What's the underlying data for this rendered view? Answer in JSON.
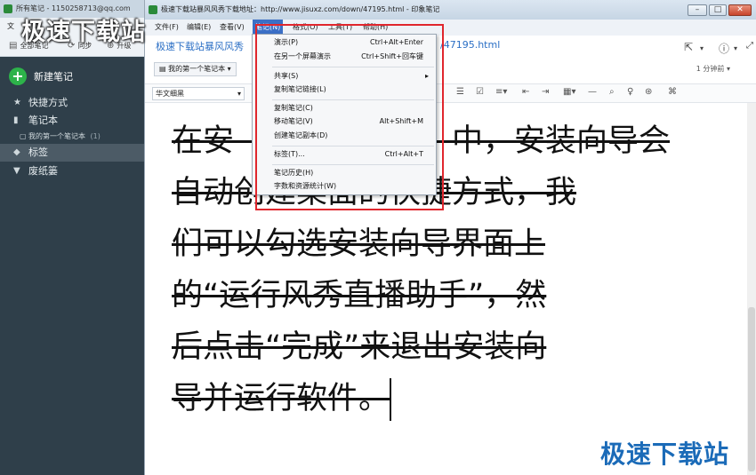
{
  "left_window": {
    "title": "所有笔记 - 1150258713@qq.com",
    "menu": [
      "文",
      "查"
    ],
    "toolbar": {
      "all_notes": "全部笔记",
      "sync": "同步",
      "upgrade": "升级"
    },
    "new_note": "新建笔记",
    "nav": {
      "shortcuts": "快捷方式",
      "notebooks": "笔记本",
      "my_first_notebook": "我的第一个笔记本",
      "my_first_notebook_count": "(1)",
      "tags": "标签",
      "trash": "废纸篓"
    }
  },
  "main_window": {
    "title": "极速下载站暴风风秀下载地址：http://www.jisuxz.com/down/47195.html - 印象笔记",
    "menu": {
      "file": "文件(F)",
      "edit": "编辑(E)",
      "view": "查看(V)",
      "note": "笔记(N)",
      "format": "格式(O)",
      "tools": "工具(T)",
      "help": "帮助(H)"
    },
    "note_title_left": "极速下载站暴风风秀",
    "note_title_right": "/47195.html",
    "notebook_selector": "我的第一个笔记本",
    "time_ago": "1 分钟前",
    "font_name": "华文细黑"
  },
  "note_menu": {
    "present": {
      "label": "演示(P)",
      "shortcut": "Ctrl+Alt+Enter"
    },
    "present_other": {
      "label": "在另一个屏幕演示",
      "shortcut": "Ctrl+Shift+回车键"
    },
    "share": {
      "label": "共享(S)"
    },
    "copy_link": {
      "label": "复制笔记链接(L)"
    },
    "copy_note": {
      "label": "复制笔记(C)"
    },
    "move_note": {
      "label": "移动笔记(V)",
      "shortcut": "Alt+Shift+M"
    },
    "create_copy": {
      "label": "创建笔记副本(D)"
    },
    "tags": {
      "label": "标签(T)...",
      "shortcut": "Ctrl+Alt+T"
    },
    "history": {
      "label": "笔记历史(H)"
    },
    "stats": {
      "label": "字数和资源统计(W)"
    }
  },
  "editor": {
    "lines": [
      "在安　　　　　　　中，安装向导会",
      "自动创建桌面的快捷方式，我",
      "们可以勾选安装向导界面上",
      "的“运行风秀直播助手”，然",
      "后点击“完成”来退出安装向",
      "导并运行软件。"
    ]
  },
  "watermarks": {
    "top": "极速下载站",
    "bottom": "极速下载站"
  },
  "colors": {
    "accent_blue": "#3b6fc6",
    "link_blue": "#2b6fc5",
    "highlight_red": "#e0262d",
    "sidebar_bg": "#2f3f4a",
    "new_note_green": "#2db34a"
  }
}
